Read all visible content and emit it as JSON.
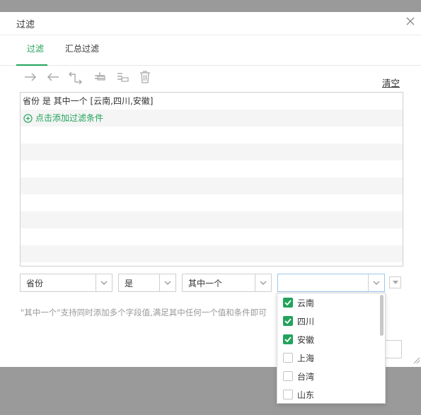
{
  "dialog": {
    "title": "过滤"
  },
  "tabs": [
    {
      "label": "过滤",
      "active": true
    },
    {
      "label": "汇总过滤",
      "active": false
    }
  ],
  "toolbar": {
    "icons": [
      "arrow-right-icon",
      "arrow-left-icon",
      "indent-icon",
      "add-above-icon",
      "add-below-icon",
      "trash-icon"
    ],
    "clear_label": "清空"
  },
  "filter_list": {
    "condition_text": "省份 是 其中一个 [云南,四川,安徽]",
    "add_label": "点击添加过滤条件"
  },
  "editor": {
    "field": "省份",
    "operator": "是",
    "match": "其中一个",
    "value": ""
  },
  "hint": "\"其中一个\"支持同时添加多个字段值,满足其中任何一个值和条件即可",
  "dropdown": {
    "options": [
      {
        "label": "云南",
        "checked": true
      },
      {
        "label": "四川",
        "checked": true
      },
      {
        "label": "安徽",
        "checked": true
      },
      {
        "label": "上海",
        "checked": false
      },
      {
        "label": "台湾",
        "checked": false
      },
      {
        "label": "山东",
        "checked": false
      }
    ]
  },
  "colors": {
    "accent": "#22a35b",
    "overlay": "#9a9a9a"
  }
}
